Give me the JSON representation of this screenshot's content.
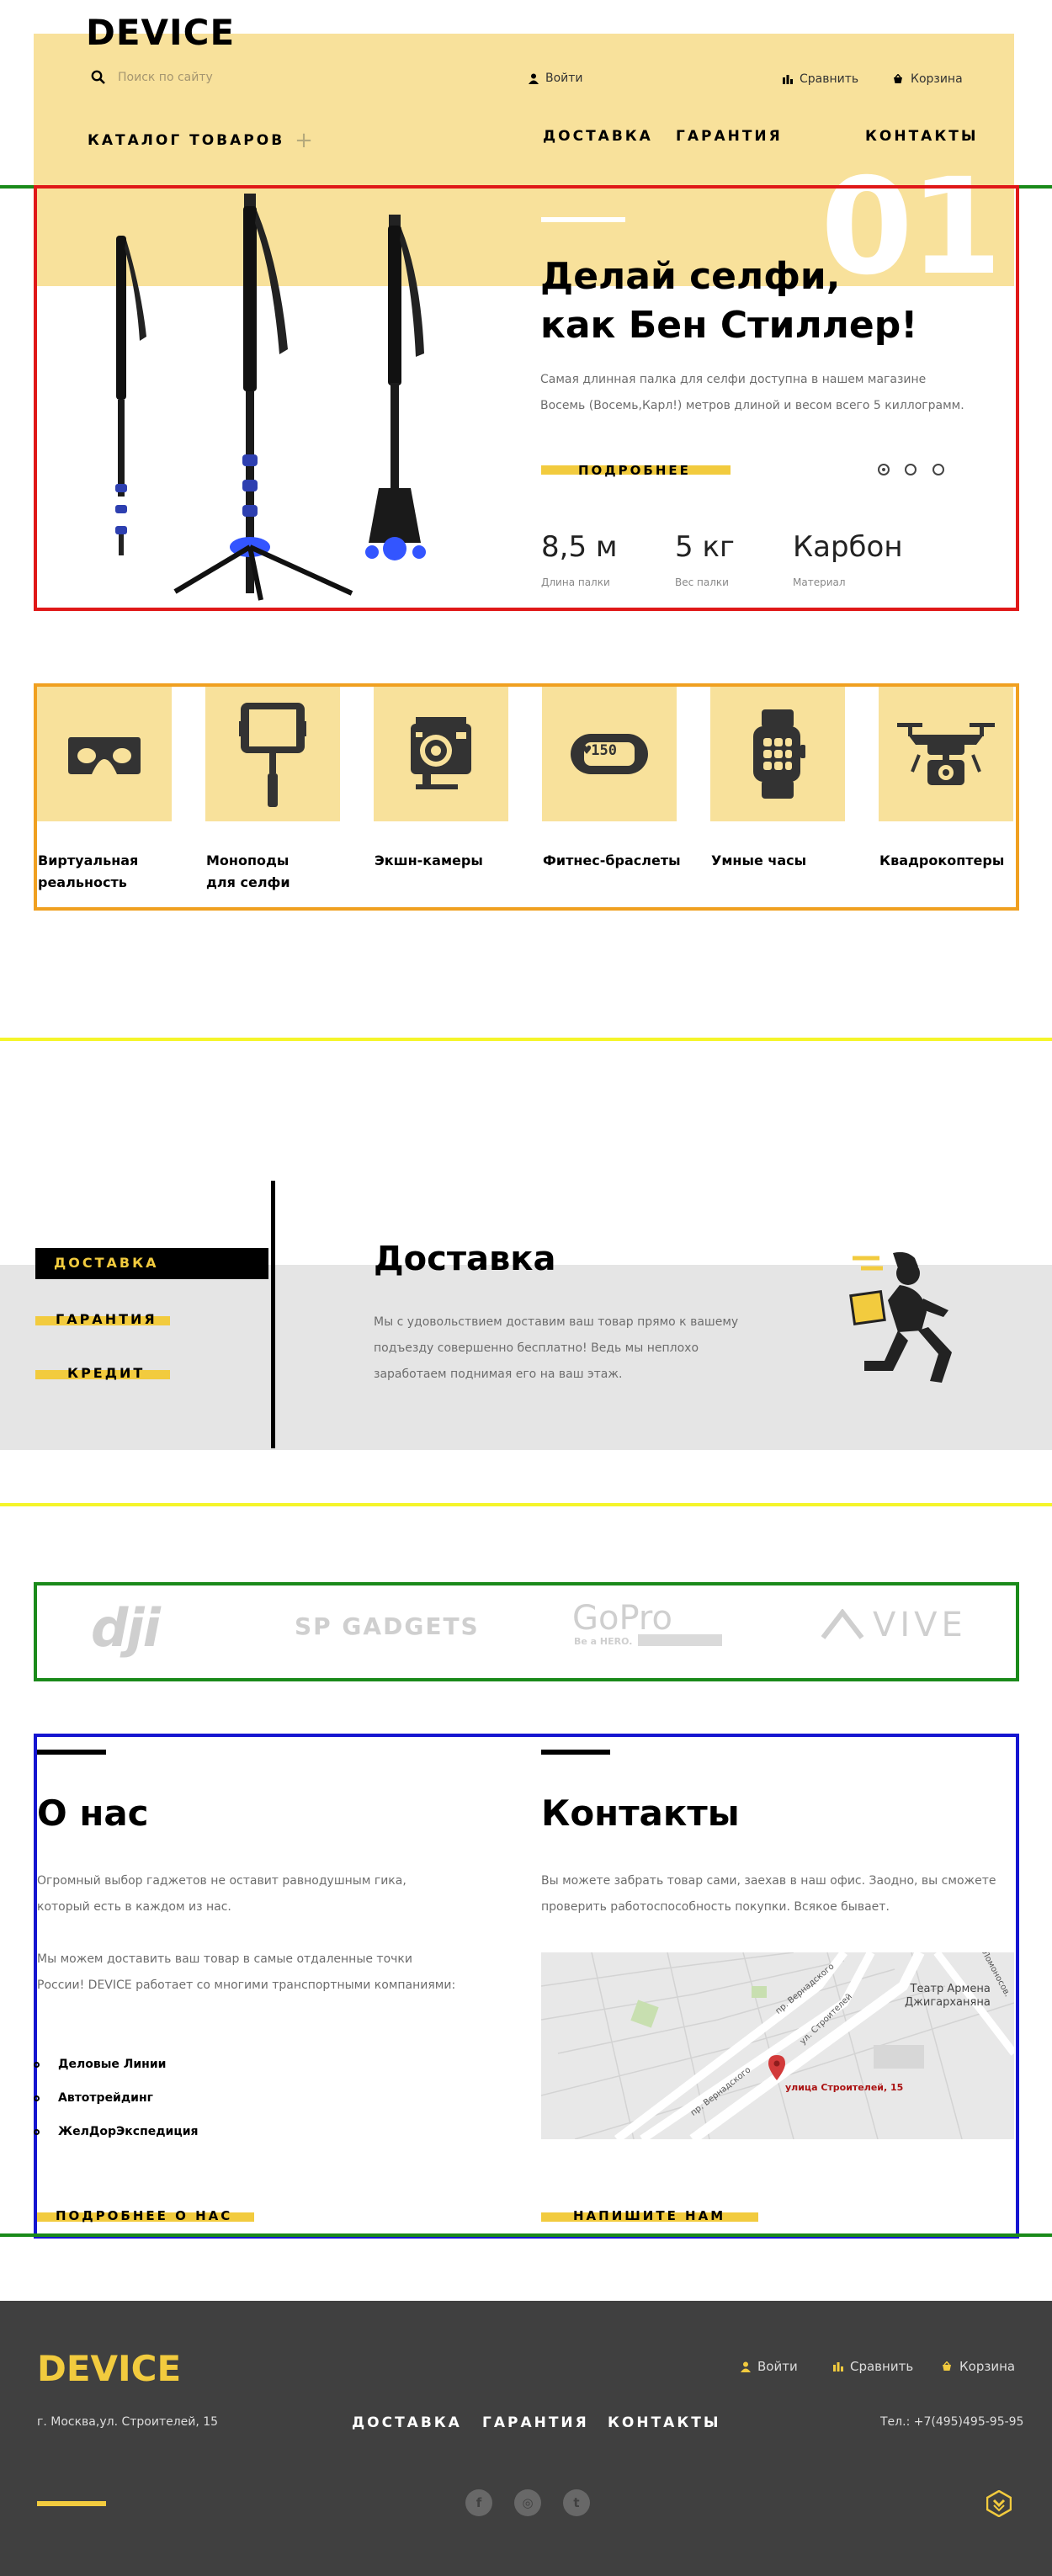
{
  "header": {
    "logo": "DEVICE",
    "search_placeholder": "Поиск по сайту",
    "login": "Войти",
    "compare": "Сравнить",
    "cart": "Корзина",
    "catalog": "КАТАЛОГ ТОВАРОВ",
    "catalog_plus": "+",
    "nav": [
      "ДОСТАВКА",
      "ГАРАНТИЯ",
      "КОНТАКТЫ"
    ]
  },
  "slider": {
    "number": "01",
    "title_line1": "Делай селфи,",
    "title_line2": "как Бен Стиллер!",
    "text_line1": "Самая длинная палка для селфи доступна в нашем магазине",
    "text_line2": "Восемь (Восемь,Карл!) метров длиной и весом всего 5 киллограмм.",
    "more": "ПОДРОБНЕЕ",
    "stats": [
      {
        "value": "8,5 м",
        "label": "Длина палки"
      },
      {
        "value": "5 кг",
        "label": "Вес палки"
      },
      {
        "value": "Карбон",
        "label": "Материал"
      }
    ]
  },
  "categories": [
    {
      "line1": "Виртуальная",
      "line2": "реальность",
      "icon": "vr-headset-icon"
    },
    {
      "line1": "Моноподы",
      "line2": "для селфи",
      "icon": "monopod-icon"
    },
    {
      "line1": "Экшн-камеры",
      "line2": "",
      "icon": "action-camera-icon"
    },
    {
      "line1": "Фитнес-браслеты",
      "line2": "",
      "icon": "fitness-band-icon"
    },
    {
      "line1": "Умные часы",
      "line2": "",
      "icon": "smart-watch-icon"
    },
    {
      "line1": "Квадрокоптеры",
      "line2": "",
      "icon": "drone-icon"
    }
  ],
  "fitness_display": "♥150",
  "services": {
    "tabs": [
      "ДОСТАВКА",
      "ГАРАНТИЯ",
      "КРЕДИТ"
    ],
    "title": "Доставка",
    "text_line1": "Мы с удовольствием доставим ваш товар прямо к вашему",
    "text_line2": "подъезду совершенно бесплатно! Ведь мы неплохо",
    "text_line3": "заработаем поднимая его на ваш этаж."
  },
  "brands": [
    "dji",
    "SP GADGETS",
    "GoPro",
    "VIVE"
  ],
  "gopro_tag": "Be a HERO.",
  "about": {
    "title": "О нас",
    "p1_line1": "Огромный выбор гаджетов не оставит равнодушным гика,",
    "p1_line2": "который есть в каждом из нас.",
    "p2_line1": "Мы можем доставить ваш товар в самые отдаленные точки",
    "p2_line2": "России! DEVICE работает со многими транспортными компаниями:",
    "list": [
      "Деловые Линии",
      "Автотрейдинг",
      "ЖелДорЭкспедиция"
    ],
    "more": "ПОДРОБНЕЕ О НАС"
  },
  "contacts": {
    "title": "Контакты",
    "p_line1": "Вы можете забрать товар сами, заехав в наш офис. Заодно, вы сможете",
    "p_line2": "проверить работоспособность покупки. Всякое бывает.",
    "map_label": "улица Строителей, 15",
    "map_theatre_line1": "Театр Армена",
    "map_theatre_line2": "Джигарханяна",
    "map_streets": [
      "пр. Вернадского",
      "пр. Вернадского",
      "ул. Строителей",
      "Ломоносов."
    ],
    "write": "НАПИШИТЕ НАМ"
  },
  "footer": {
    "logo": "DEVICE",
    "address": "г. Москва,ул. Строителей, 15",
    "nav": [
      "ДОСТАВКА",
      "ГАРАНТИЯ",
      "КОНТАКТЫ"
    ],
    "login": "Войти",
    "compare": "Сравнить",
    "cart": "Корзина",
    "phone": "Тел.: +7(495)495-95-95",
    "social": [
      "f",
      "◎",
      "t"
    ]
  },
  "colors": {
    "accent": "#f2cb3e",
    "light_yellow": "#f8e19b",
    "footer": "#404040"
  }
}
